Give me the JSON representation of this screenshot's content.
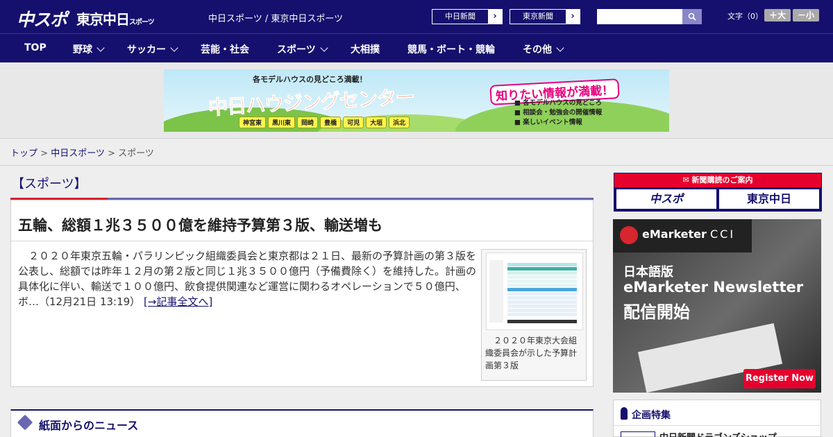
{
  "header": {
    "logo_chuspo": "中スポ",
    "logo_tokyo": "東京中日",
    "logo_tokyo_sub": "スポーツ",
    "site_names": "中日スポーツ / 東京中日スポーツ",
    "links": [
      {
        "label": "中日新聞"
      },
      {
        "label": "東京新聞"
      }
    ],
    "link_arrow": "›",
    "search_placeholder": "",
    "font_size_label": "文字（0）",
    "font_bigger": "＋大",
    "font_smaller": "－小"
  },
  "nav": {
    "items": [
      {
        "label": "TOP"
      },
      {
        "label": "野球"
      },
      {
        "label": "サッカー"
      },
      {
        "label": "芸能・社会"
      },
      {
        "label": "スポーツ"
      },
      {
        "label": "大相撲"
      },
      {
        "label": "競馬・ボート・競輪"
      },
      {
        "label": "その他"
      }
    ]
  },
  "banner": {
    "top_line": "各モデルハウスの見どころ満載！",
    "title": "中日ハウジングセンター",
    "catch": "知りたい情報が満載！",
    "bullets": [
      "各モデルハウスの見どころ",
      "相談会・勉強会の開催情報",
      "楽しいイベント情報"
    ],
    "towns": [
      "神宮東",
      "黒川東",
      "岡崎",
      "豊橋",
      "可児",
      "大垣",
      "浜北"
    ]
  },
  "breadcrumb": {
    "top": "トップ",
    "sep": " > ",
    "chunichi": "中日スポーツ",
    "current": "スポーツ"
  },
  "section": {
    "title": "【スポーツ】"
  },
  "article": {
    "title": "五輪、総額１兆３５００億を維持予算第３版、輸送増も",
    "body": "２０２０年東京五輪・パラリンピック組織委員会と東京都は２１日、最新の予算計画の第３版を公表し、総額では昨年１２月の第２版と同じ１兆３５００億円（予備費除く）を維持した。計画の具体化に伴い、輸送で１００億円、飲食提供関連など運営に関わるオペレーションで５０億円、ボ…（12月21日 13:19）",
    "more": "[→記事全文へ]",
    "photo_caption": "２０２０年東京大会組織委員会が示した予算計画第３版"
  },
  "news": {
    "title": "紙面からのニュース"
  },
  "sidebar": {
    "subscribe_head": "新聞購読のご案内",
    "sub_logo_1": "中スポ",
    "sub_logo_2": "東京中日",
    "ad": {
      "brand": "eMarketer",
      "partner": "CCI",
      "jp": "日本語版",
      "newsletter": "eMarketer Newsletter",
      "launch": "配信開始",
      "register": "Register Now"
    },
    "feature_title": "企画特集",
    "feature_item": "中日新聞ドラゴンズショップ"
  },
  "colors": {
    "navy": "#15106e",
    "accent_red": "#d8262e",
    "accent_purple": "#6a66b0"
  }
}
